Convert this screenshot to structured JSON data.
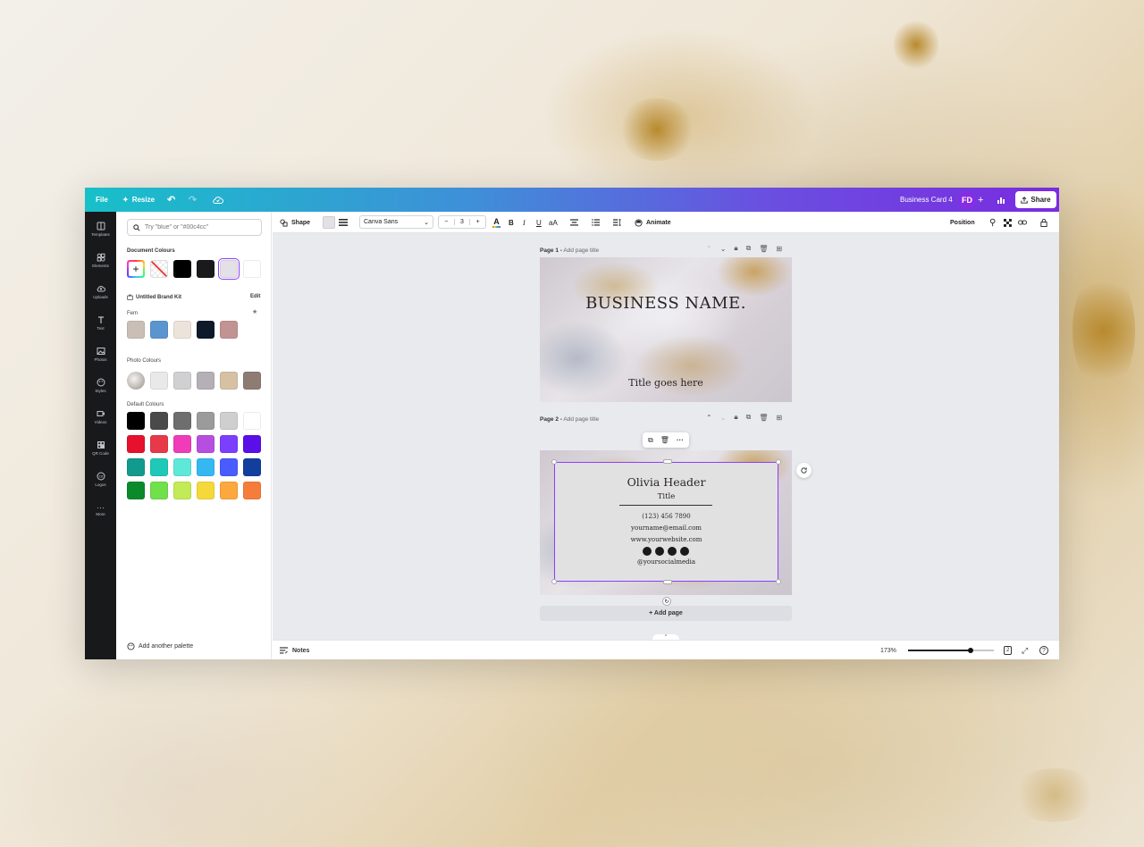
{
  "topbar": {
    "file": "File",
    "resize": "Resize",
    "doc_title": "Business Card 4",
    "avatar": "FD",
    "share": "Share"
  },
  "rail": [
    "Templates",
    "Elements",
    "Uploads",
    "Text",
    "Photos",
    "Styles",
    "Videos",
    "QR Code",
    "Logos",
    "More"
  ],
  "panel": {
    "search_placeholder": "Try \"blue\" or \"#00c4cc\"",
    "document_colours_title": "Document Colours",
    "document_colours": [
      "#000000",
      "#1a1a1c",
      "#e4e0e8",
      "#ffffff"
    ],
    "brand_kit_title": "Untitled Brand Kit",
    "brand_kit_edit": "Edit",
    "palette_name": "Fem",
    "palette_colours": [
      "#c9bfb6",
      "#5b95cf",
      "#ece3da",
      "#0e1a2a",
      "#c29393"
    ],
    "photo_colours_title": "Photo Colours",
    "photo_colours": [
      "#e9e9e9",
      "#d0d0d2",
      "#b5b0b8",
      "#d6c2a3",
      "#8e7c73"
    ],
    "default_colours_title": "Default Colours",
    "default_colours": [
      [
        "#000000",
        "#4a4a4a",
        "#6e6e6e",
        "#9b9b9b",
        "#cfcfcf",
        "#ffffff"
      ],
      [
        "#e8112d",
        "#e8394a",
        "#f03cb8",
        "#b64fe0",
        "#7a3fff",
        "#5a0fe8"
      ],
      [
        "#139a8e",
        "#1ec9b8",
        "#5ee8d9",
        "#35b8f2",
        "#4a5bff",
        "#123f9e"
      ],
      [
        "#0b8a2b",
        "#70e04b",
        "#c3ea57",
        "#f5d93a",
        "#fca83e",
        "#f67c3c"
      ]
    ],
    "add_palette": "Add another palette"
  },
  "toolbar": {
    "shape": "Shape",
    "font": "Canva Sans",
    "font_size": "3",
    "minus": "−",
    "plus": "+",
    "bold": "B",
    "italic": "I",
    "underline": "U",
    "case": "aA",
    "animate": "Animate",
    "position": "Position"
  },
  "pages": [
    {
      "label": "Page 1",
      "add_title": "Add page title",
      "business_name": "BUSINESS NAME.",
      "subtitle": "Title goes here"
    },
    {
      "label": "Page 2",
      "add_title": "Add page title",
      "name": "Olivia Header",
      "title": "Title",
      "phone": "(123) 456 7890",
      "email": "yourname@email.com",
      "website": "www.yourwebsite.com",
      "social": "@yoursocialmedia"
    }
  ],
  "add_page": "+ Add page",
  "status": {
    "notes": "Notes",
    "zoom": "173%",
    "zoom_fraction": 0.73,
    "page_count": "2"
  }
}
